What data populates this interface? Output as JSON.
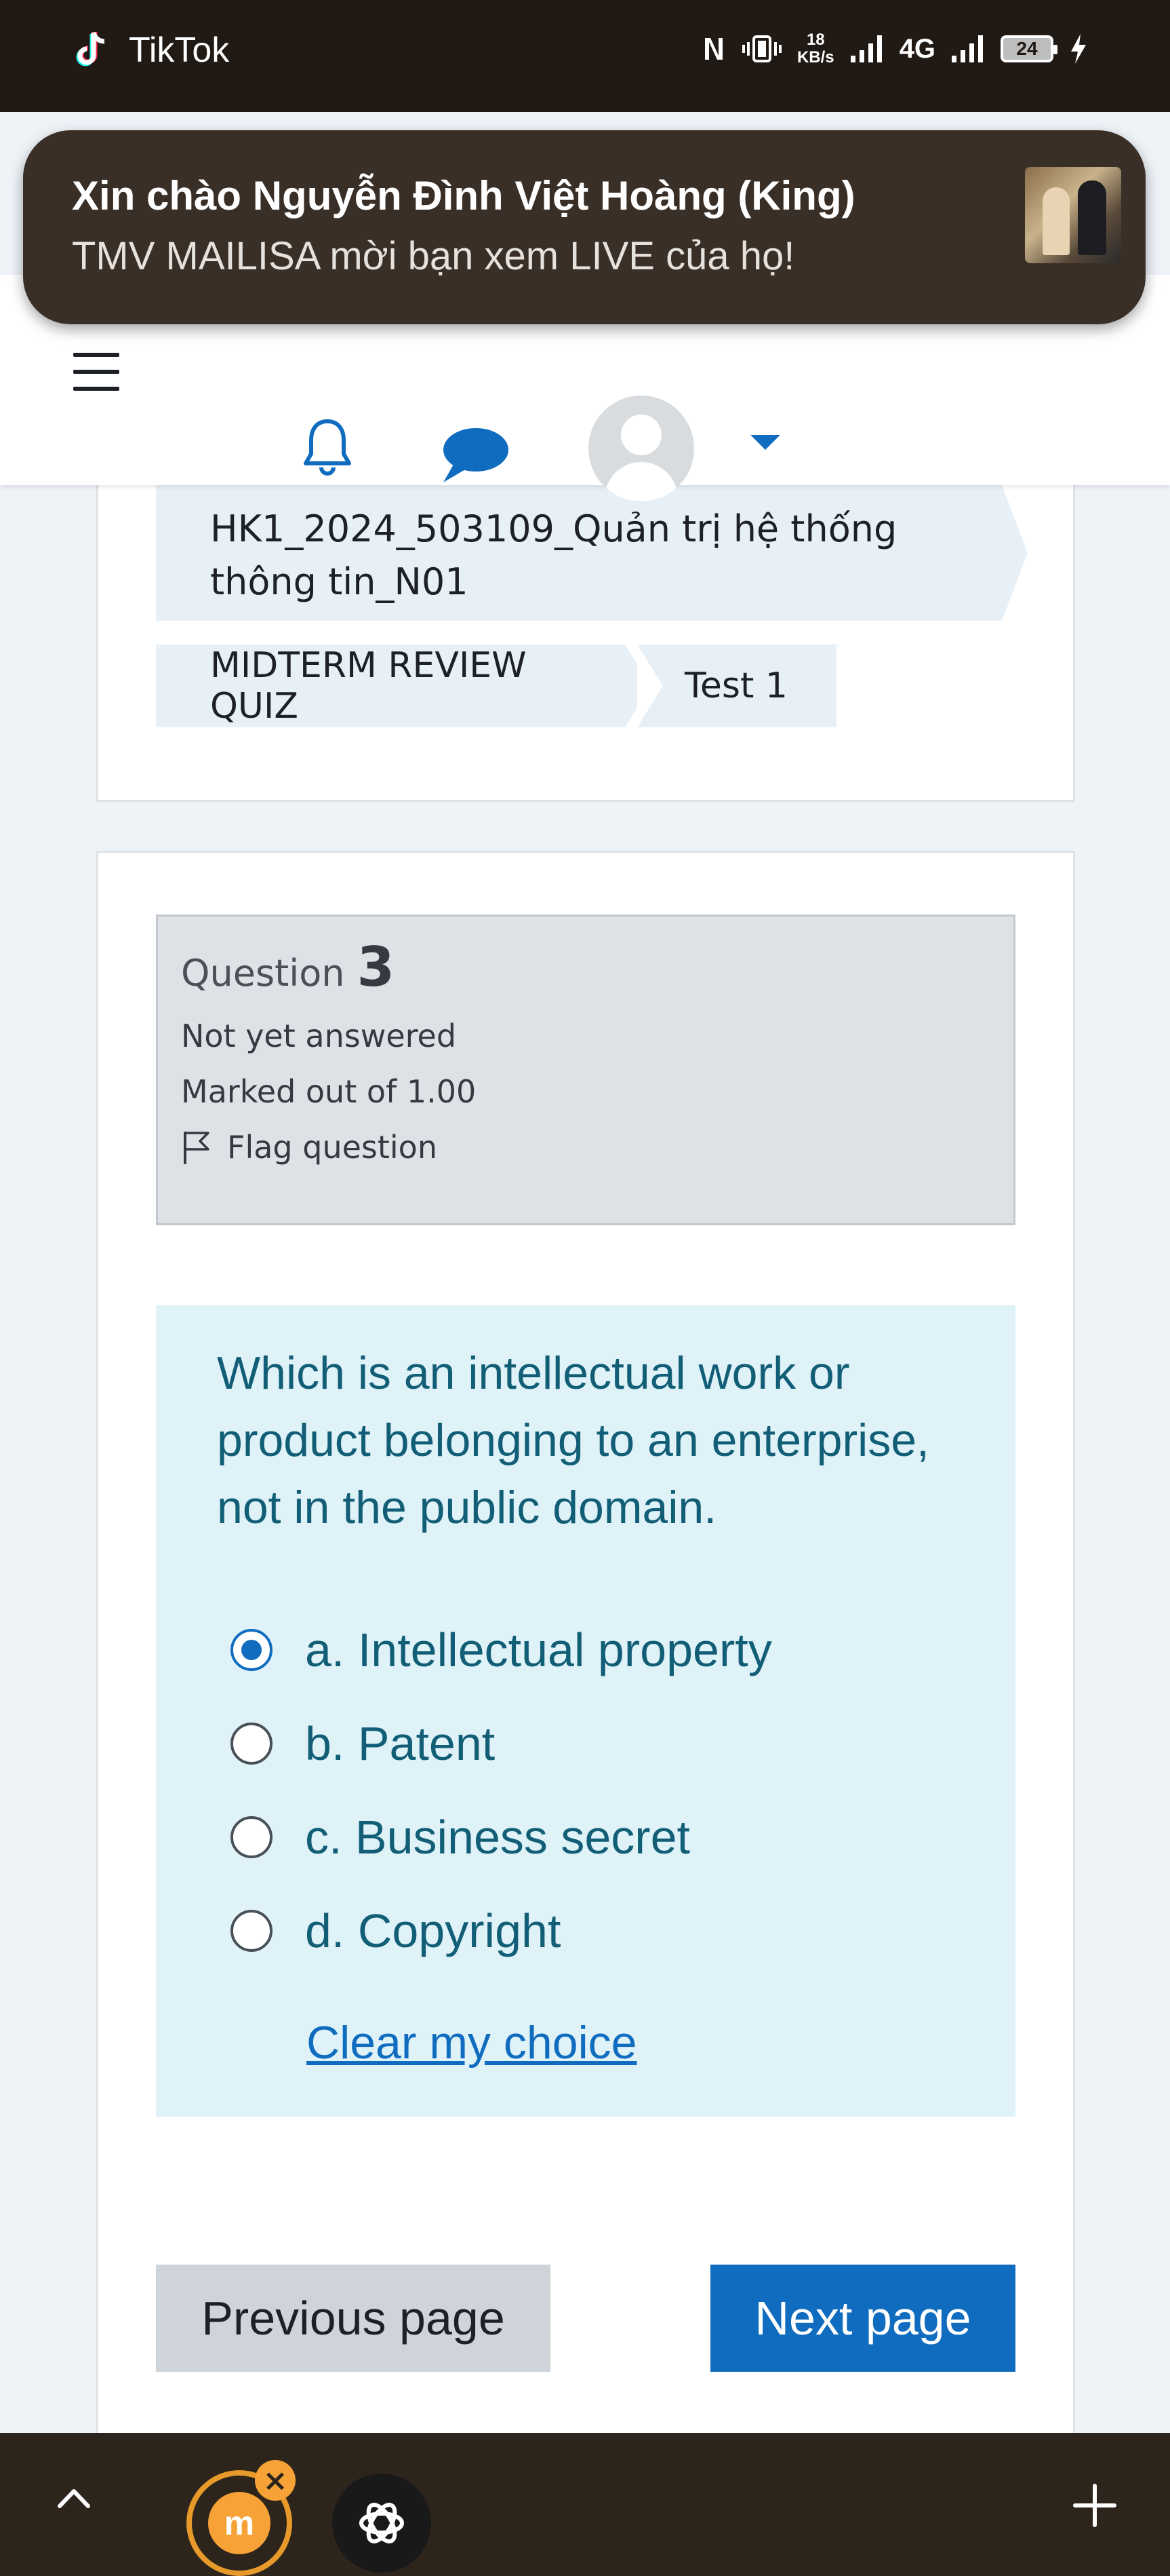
{
  "status_bar": {
    "app_name": "TikTok",
    "net_speed_value": "18",
    "net_speed_unit": "KB/s",
    "network_type": "4G",
    "battery_level": "24"
  },
  "notification": {
    "title": "Xin chào Nguyễn Đình Việt Hoàng (King)",
    "message": "TMV MAILISA mời bạn xem LIVE của họ!"
  },
  "breadcrumb": {
    "course": "HK1_2024_503109_Quản trị hệ thống thông tin_N01",
    "quiz": "MIDTERM REVIEW QUIZ",
    "attempt": "Test 1"
  },
  "question_info": {
    "label": "Question",
    "number": "3",
    "status": "Not yet answered",
    "marks": "Marked out of 1.00",
    "flag_label": "Flag question"
  },
  "question": {
    "text": "Which is an intellectual work or product belonging to an enterprise, not in the public domain.",
    "answers": [
      {
        "label": "a. Intellectual property",
        "selected": true
      },
      {
        "label": "b. Patent",
        "selected": false
      },
      {
        "label": "c. Business secret",
        "selected": false
      },
      {
        "label": "d. Copyright",
        "selected": false
      }
    ],
    "clear_label": "Clear my choice"
  },
  "navigation": {
    "previous_label": "Previous page",
    "next_label": "Next page"
  },
  "colors": {
    "primary": "#0f6cbf",
    "question_text": "#115e76",
    "question_bg": "#def2f8",
    "status_bar_bg": "#201914"
  }
}
